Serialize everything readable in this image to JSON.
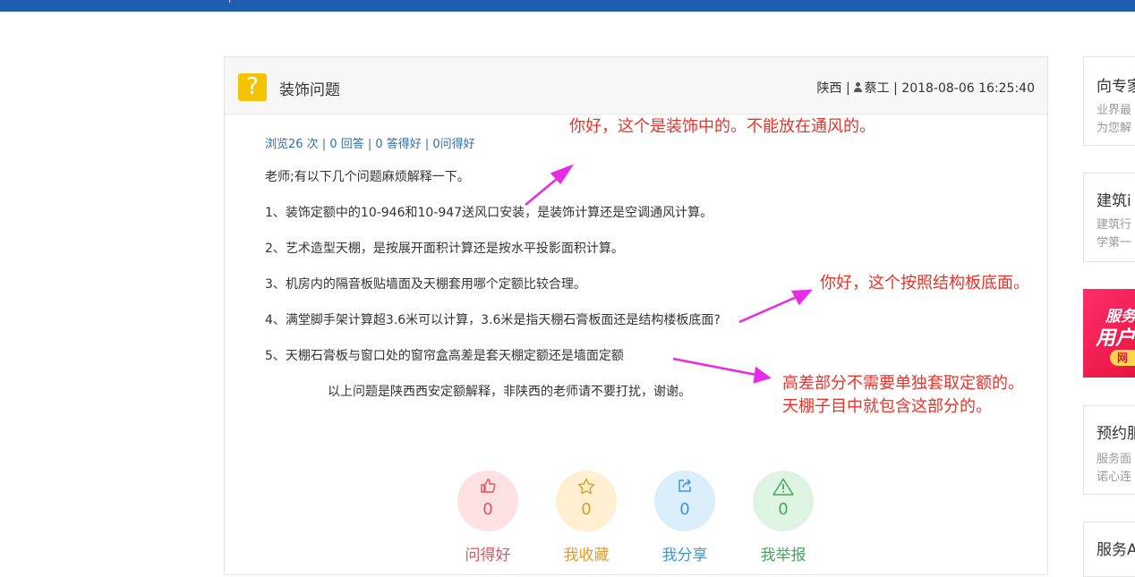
{
  "question": {
    "title": "装饰问题",
    "icon": "question-mark-icon",
    "meta": {
      "region": "陕西",
      "user": "蔡工",
      "datetime": "2018-08-06 16:25:40"
    },
    "stats": "浏览26 次 | 0 回答 | 0 答得好 | 0问得好",
    "intro": "老师;有以下几个问题麻烦解释一下。",
    "items": [
      "1、装饰定额中的10-946和10-947送风口安装，是装饰计算还是空调通风计算。",
      "2、艺术造型天棚，是按展开面积计算还是按水平投影面积计算。",
      "3、机房内的隔音板贴墙面及天棚套用哪个定额比较合理。",
      "4、满堂脚手架计算超3.6米可以计算，3.6米是指天棚石膏板面还是结构楼板底面?",
      "5、天棚石膏板与窗口处的窗帘盒高差是套天棚定额还是墙面定额"
    ],
    "closing": "以上问题是陕西西安定额解释，非陕西的老师请不要打扰，谢谢。"
  },
  "actions": [
    {
      "label": "问得好",
      "count": "0",
      "icon": "thumbs-up-icon",
      "color": "#e0545f",
      "bg": "#fde1e3"
    },
    {
      "label": "我收藏",
      "count": "0",
      "icon": "star-icon",
      "color": "#e09d2f",
      "bg": "#fdefcf"
    },
    {
      "label": "我分享",
      "count": "0",
      "icon": "share-icon",
      "color": "#3e98d6",
      "bg": "#daeefb"
    },
    {
      "label": "我举报",
      "count": "0",
      "icon": "warning-icon",
      "color": "#45a85a",
      "bg": "#dff3e3"
    }
  ],
  "annotations": {
    "a1": "你好，这个是装饰中的。不能放在通风的。",
    "a2": "你好，这个按照结构板底面。",
    "a3_line1": "高差部分不需要单独套取定额的。",
    "a3_line2": "天棚子目中就包含这部分的。",
    "color": "#e8332a",
    "arrow_color": "#e62ae6"
  },
  "sidebar": {
    "card1": {
      "title": "向专家",
      "desc1": "业界最",
      "desc2": "为您解"
    },
    "card2": {
      "title": "建筑i",
      "desc1": "建筑行",
      "desc2": "学第一"
    },
    "banner": {
      "line1": "服务",
      "line2": "用户",
      "badge": "网"
    },
    "card3": {
      "title": "预约服",
      "desc1": "服务面",
      "desc2": "诺心连"
    },
    "card4": {
      "title": "服务A"
    }
  }
}
